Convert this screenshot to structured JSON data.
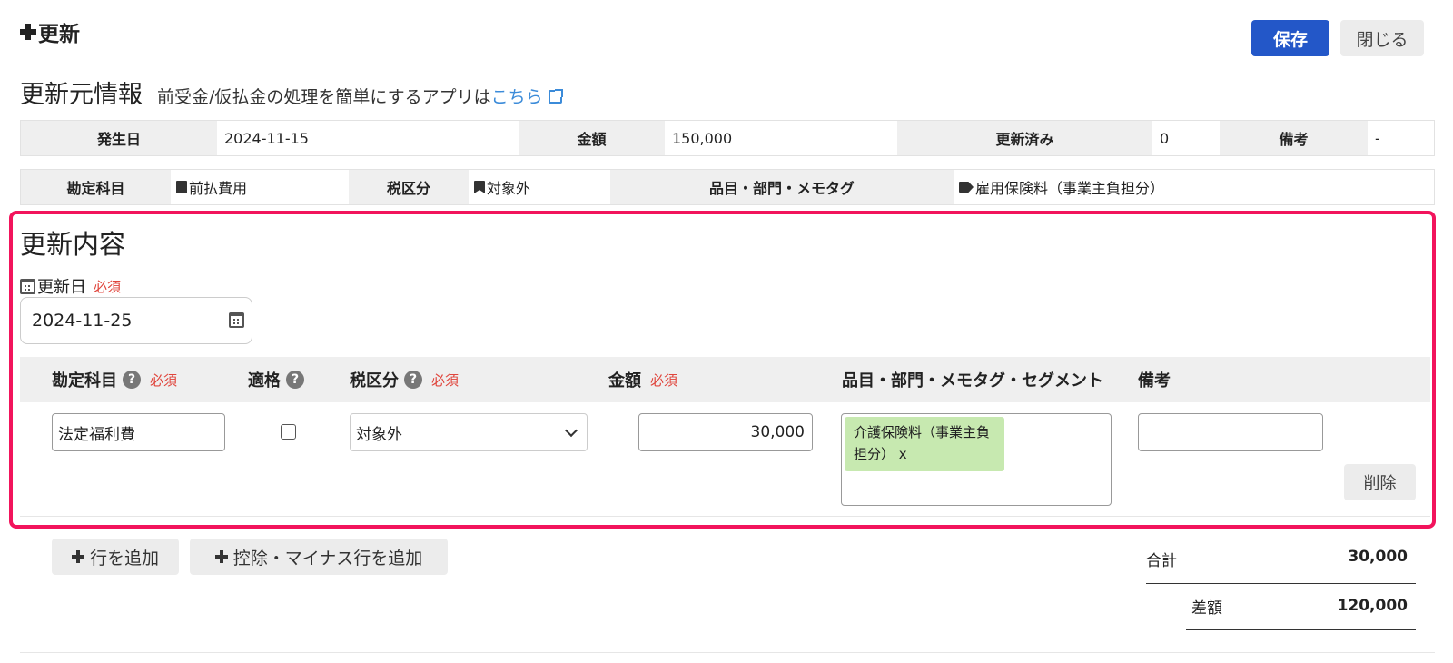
{
  "header": {
    "title": "更新",
    "save_label": "保存",
    "close_label": "閉じる"
  },
  "source": {
    "title": "更新元情報",
    "subtitle": "前受金/仮払金の処理を簡単にするアプリは",
    "link_text": "こちら",
    "row1": {
      "date_label": "発生日",
      "date_value": "2024-11-15",
      "amount_label": "金額",
      "amount_value": "150,000",
      "updated_label": "更新済み",
      "updated_value": "0",
      "memo_label": "備考",
      "memo_value": "-"
    },
    "row2": {
      "account_label": "勘定科目",
      "account_value": "前払費用",
      "tax_label": "税区分",
      "tax_value": "対象外",
      "tags_label": "品目・部門・メモタグ",
      "tags_value": "雇用保険料（事業主負担分）"
    }
  },
  "edit": {
    "title": "更新内容",
    "date_label": "更新日",
    "required": "必須",
    "date_value": "2024-11-25",
    "columns": {
      "account": "勘定科目",
      "qualified": "適格",
      "tax": "税区分",
      "amount": "金額",
      "tags": "品目・部門・メモタグ・セグメント",
      "memo": "備考"
    },
    "row": {
      "account": "法定福利費",
      "qualified": false,
      "tax": "対象外",
      "amount": "30,000",
      "tag_chip": "介護保険料（事業主負担分） x",
      "memo": "",
      "delete_label": "削除"
    }
  },
  "footer": {
    "add_row": "行を追加",
    "add_minus_row": "控除・マイナス行を追加",
    "total_label": "合計",
    "total_value": "30,000",
    "diff_label": "差額",
    "diff_value": "120,000"
  },
  "colors": {
    "primary": "#2357c8",
    "highlight": "#f2145c",
    "required": "#e0453c",
    "link": "#3b8bd9",
    "chip": "#c7e9b0"
  },
  "icons": [
    "plus-icon",
    "external-link-icon",
    "book-icon",
    "bookmark-icon",
    "tag-icon",
    "calendar-icon",
    "help-icon",
    "chevron-down-icon"
  ]
}
